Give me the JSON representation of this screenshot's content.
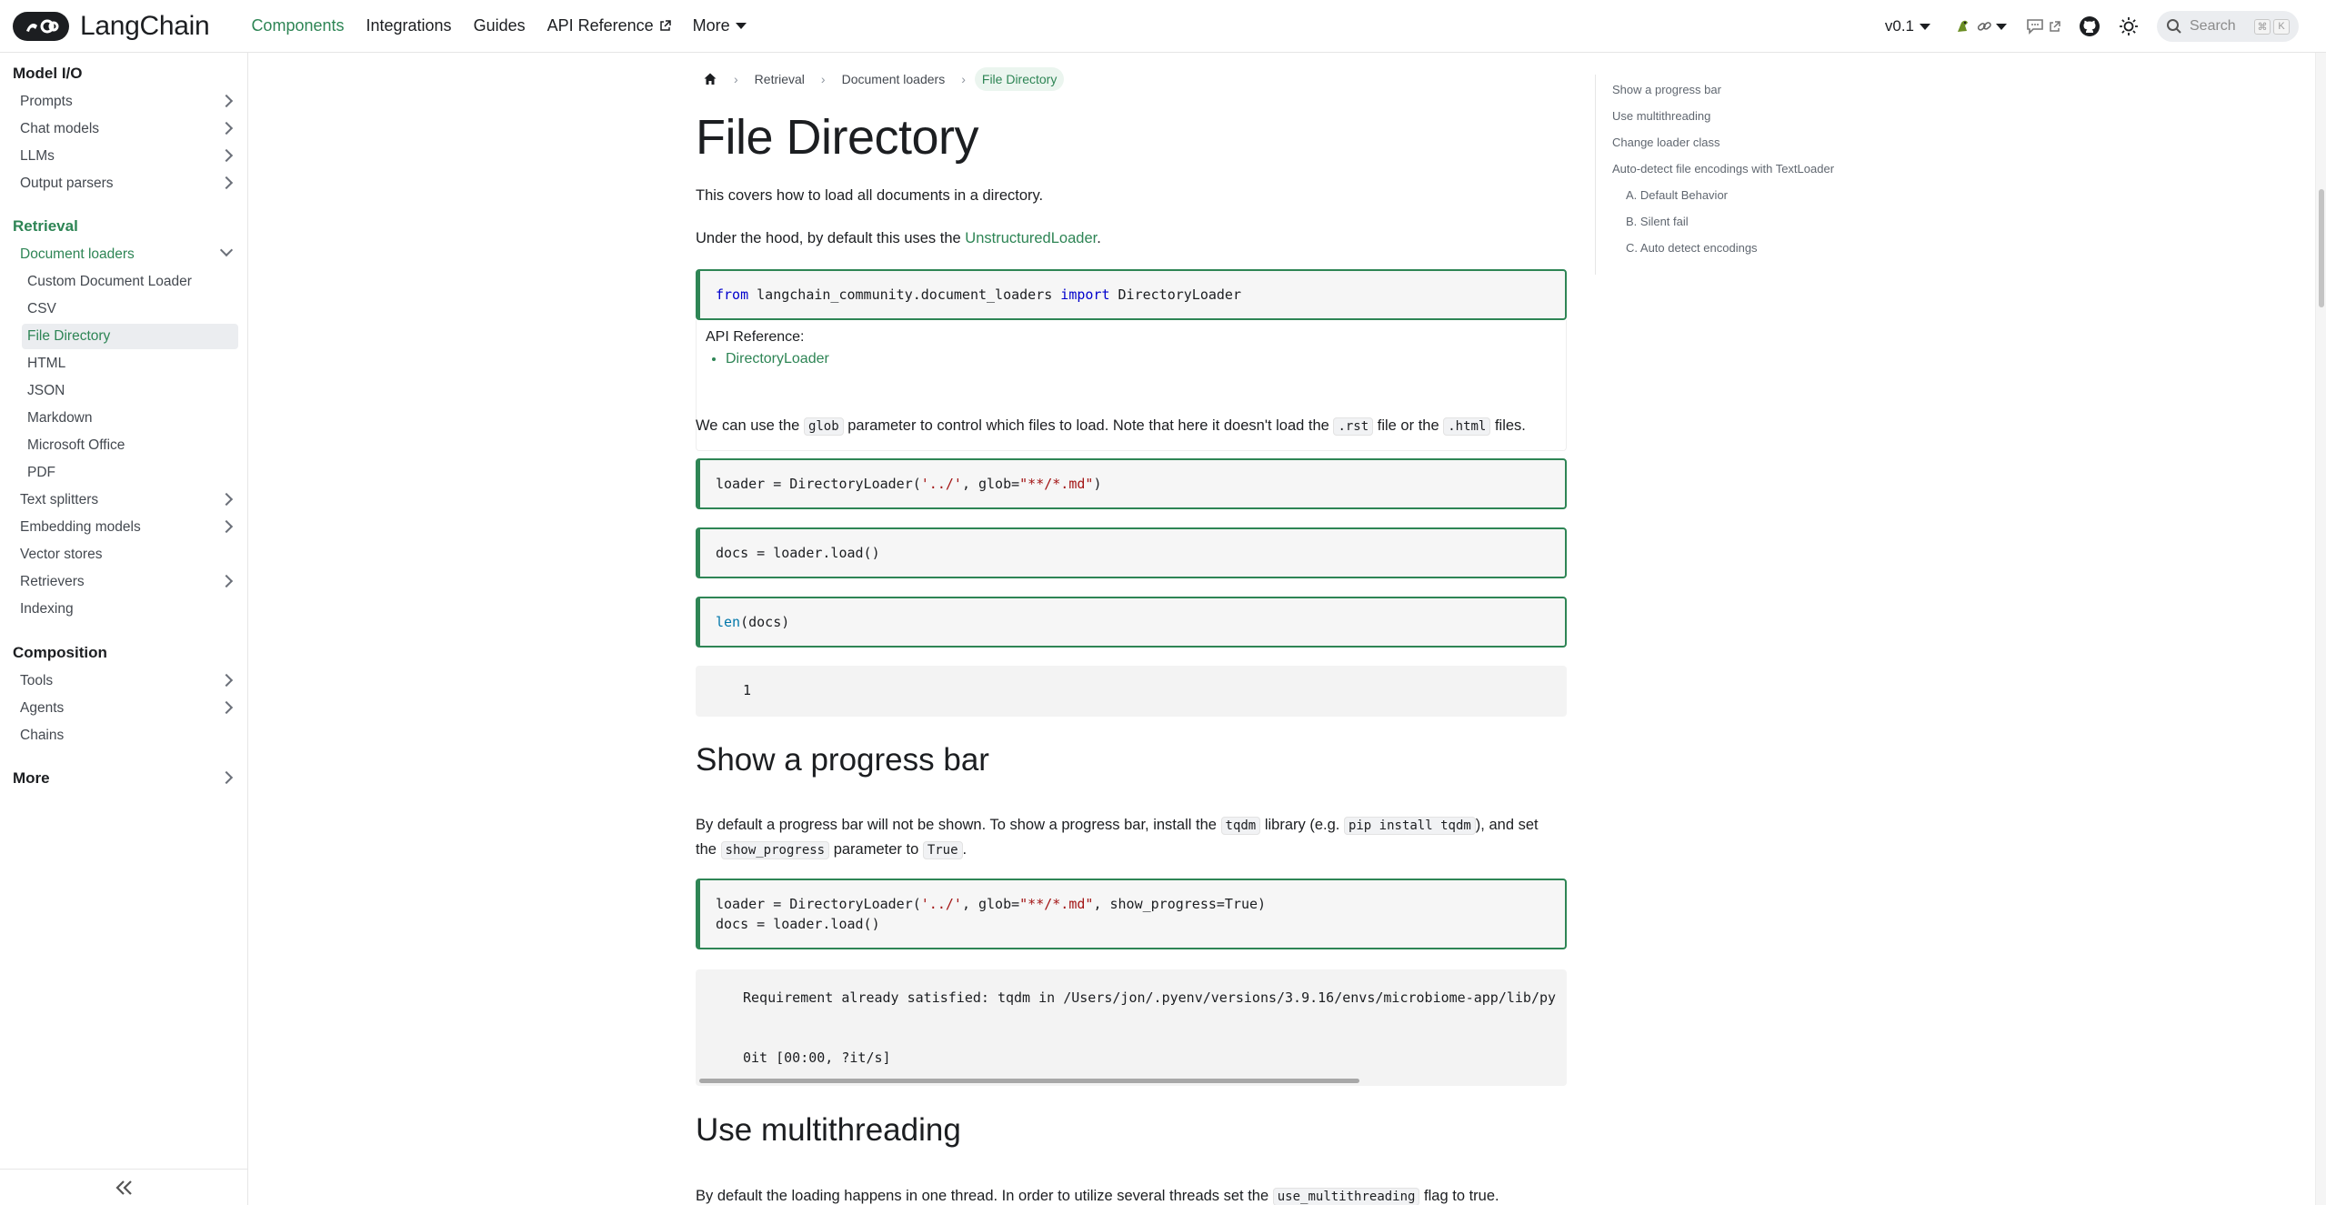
{
  "navbar": {
    "brand": "LangChain",
    "links": [
      "Components",
      "Integrations",
      "Guides",
      "API Reference",
      "More"
    ],
    "version": "v0.1",
    "search_placeholder": "Search",
    "kbd": [
      "⌘",
      "K"
    ],
    "accent": "#2e8555"
  },
  "sidebar": {
    "sections": {
      "model_io": "Model I/O",
      "retrieval": "Retrieval",
      "composition": "Composition",
      "more": "More"
    },
    "model_io_items": [
      "Prompts",
      "Chat models",
      "LLMs",
      "Output parsers"
    ],
    "retrieval_items": [
      "Document loaders",
      "Custom Document Loader",
      "CSV",
      "File Directory",
      "HTML",
      "JSON",
      "Markdown",
      "Microsoft Office",
      "PDF",
      "Text splitters",
      "Embedding models",
      "Vector stores",
      "Retrievers",
      "Indexing"
    ],
    "composition_items": [
      "Tools",
      "Agents",
      "Chains"
    ],
    "collapse_icon": "double-chevron-left-icon"
  },
  "breadcrumbs": [
    "Retrieval",
    "Document loaders",
    "File Directory"
  ],
  "page": {
    "title": "File Directory",
    "intro": "This covers how to load all documents in a directory.",
    "hood_prefix": "Under the hood, by default this uses the ",
    "hood_link": "UnstructuredLoader",
    "hood_suffix": ".",
    "code1": {
      "kw1": "from",
      "mod": " langchain_community.document_loaders ",
      "kw2": "import",
      "rest": " DirectoryLoader"
    },
    "api_ref_label": "API Reference:",
    "api_ref_item": "DirectoryLoader",
    "glob_p": {
      "a": "We can use the ",
      "c1": "glob",
      "b": " parameter to control which files to load. Note that here it doesn't load the ",
      "c2": ".rst",
      "c": " file or the ",
      "c3": ".html",
      "d": " files."
    },
    "code2": {
      "a": "loader = DirectoryLoader(",
      "s1": "'../'",
      "b": ", glob=",
      "s2": "\"**/*.md\"",
      "c": ")"
    },
    "code3": "docs = loader.load()",
    "code4": {
      "fn": "len",
      "rest": "(docs)"
    },
    "output1": "1",
    "h2_progress": "Show a progress bar",
    "progress_p": {
      "a": "By default a progress bar will not be shown. To show a progress bar, install the ",
      "c1": "tqdm",
      "b": " library (e.g. ",
      "c2": "pip install tqdm",
      "c": "), and set",
      "d": "the ",
      "c3": "show_progress",
      "e": " parameter to ",
      "c4": "True",
      "f": "."
    },
    "code5": {
      "a": "loader = DirectoryLoader(",
      "s1": "'../'",
      "b": ", glob=",
      "s2": "\"**/*.md\"",
      "c": ", show_progress=True)",
      "line2": "docs = loader.load()"
    },
    "output2_line1": "Requirement already satisfied: tqdm in /Users/jon/.pyenv/versions/3.9.16/envs/microbiome-app/lib/py",
    "output2_line2": "0it [00:00, ?it/s]",
    "h2_multithreading": "Use multithreading",
    "multi_p": {
      "a": "By default the loading happens in one thread. In order to utilize several threads set the ",
      "c1": "use_multithreading",
      "b": " flag to true."
    }
  },
  "toc": {
    "items": [
      "Show a progress bar",
      "Use multithreading",
      "Change loader class",
      "Auto-detect file encodings with TextLoader"
    ],
    "sub_items": [
      "A. Default Behavior",
      "B. Silent fail",
      "C. Auto detect encodings"
    ]
  }
}
